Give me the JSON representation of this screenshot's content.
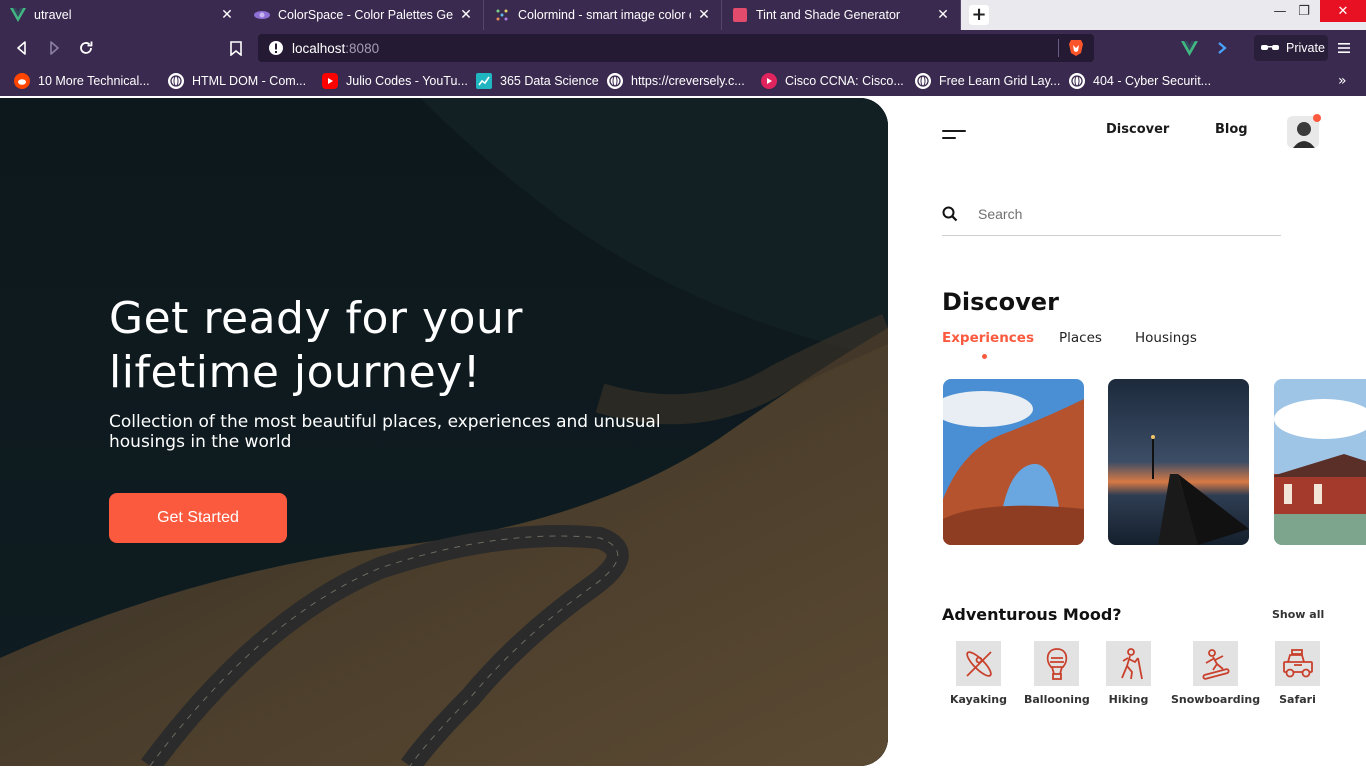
{
  "browser": {
    "tabs": [
      {
        "title": "utravel",
        "active": true
      },
      {
        "title": "ColorSpace - Color Palettes Genera",
        "active": false
      },
      {
        "title": "Colormind - smart image color ext",
        "active": false
      },
      {
        "title": "Tint and Shade Generator",
        "active": false
      }
    ],
    "url_host": "localhost",
    "url_port": ":8080",
    "private_label": "Private",
    "bookmarks": [
      {
        "label": "10 More Technical...",
        "icon": "reddit-icon",
        "color": "#ff4500"
      },
      {
        "label": "HTML DOM - Com...",
        "icon": "globe-icon",
        "color": "#ffffff"
      },
      {
        "label": "Julio Codes - YouTu...",
        "icon": "youtube-icon",
        "color": "#ff0000"
      },
      {
        "label": "365 Data Science",
        "icon": "chart-icon",
        "color": "#1fb6c1"
      },
      {
        "label": "https://creversely.c...",
        "icon": "globe-icon",
        "color": "#ffffff"
      },
      {
        "label": "Cisco CCNA: Cisco...",
        "icon": "play-icon",
        "color": "#e0245e"
      },
      {
        "label": "Free Learn Grid Lay...",
        "icon": "globe-icon",
        "color": "#ffffff"
      },
      {
        "label": "404 - Cyber Securit...",
        "icon": "globe-icon",
        "color": "#ffffff"
      }
    ]
  },
  "hero": {
    "title": "Get ready for your lifetime journey!",
    "subtitle": "Collection of the most beautiful places, experiences and unusual housings in the world",
    "cta_label": "Get Started"
  },
  "nav": {
    "discover_label": "Discover",
    "blog_label": "Blog"
  },
  "search": {
    "placeholder": "Search"
  },
  "discover": {
    "title": "Discover",
    "tabs": [
      "Experiences",
      "Places",
      "Housings"
    ],
    "active_tab": "Experiences"
  },
  "mood": {
    "title": "Adventurous Mood?",
    "show_all_label": "Show all",
    "items": [
      {
        "label": "Kayaking",
        "icon": "kayak-icon"
      },
      {
        "label": "Ballooning",
        "icon": "balloon-icon"
      },
      {
        "label": "Hiking",
        "icon": "hiking-icon"
      },
      {
        "label": "Snowboarding",
        "icon": "snowboard-icon"
      },
      {
        "label": "Safari",
        "icon": "safari-jeep-icon"
      }
    ]
  },
  "colors": {
    "accent": "#fb5a3f",
    "browser_chrome": "#3a2a4f",
    "icon_tint": "#c9412d"
  }
}
